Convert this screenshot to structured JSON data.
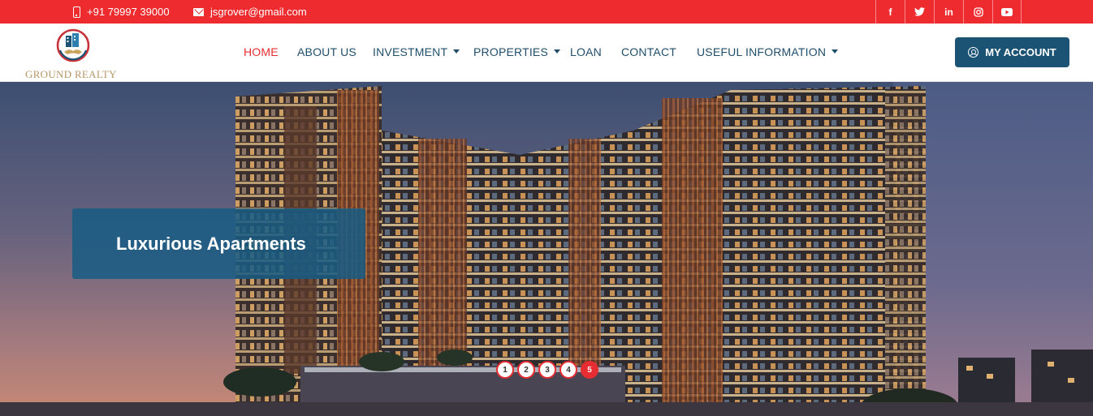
{
  "topbar": {
    "phone": "+91 79997 39000",
    "email": "jsgrover@gmail.com",
    "social": [
      {
        "icon": "facebook-icon",
        "glyph": "f"
      },
      {
        "icon": "twitter-icon",
        "glyph": "𝕥"
      },
      {
        "icon": "linkedin-icon",
        "glyph": "in"
      },
      {
        "icon": "instagram-icon",
        "glyph": "◎"
      },
      {
        "icon": "youtube-icon",
        "glyph": "▶"
      }
    ]
  },
  "header": {
    "logo_text": "GROUND REALTY",
    "nav": [
      {
        "label": "HOME",
        "active": true,
        "dropdown": false
      },
      {
        "label": "ABOUT US",
        "active": false,
        "dropdown": false
      },
      {
        "label": "INVESTMENT",
        "active": false,
        "dropdown": true
      },
      {
        "label": "PROPERTIES",
        "active": false,
        "dropdown": true
      },
      {
        "label": "LOAN",
        "active": false,
        "dropdown": false
      },
      {
        "label": "CONTACT",
        "active": false,
        "dropdown": false
      },
      {
        "label": "USEFUL INFORMATION",
        "active": false,
        "dropdown": true
      }
    ],
    "account_label": "MY ACCOUNT"
  },
  "hero": {
    "caption": "Luxurious Apartments",
    "slides": [
      "1",
      "2",
      "3",
      "4",
      "5"
    ],
    "active_slide": 5
  },
  "colors": {
    "topbar": "#ee2b2f",
    "nav_text": "#1f4e6b",
    "nav_active": "#e62d31",
    "account_button": "#1b5374",
    "caption_box": "#185c84"
  }
}
